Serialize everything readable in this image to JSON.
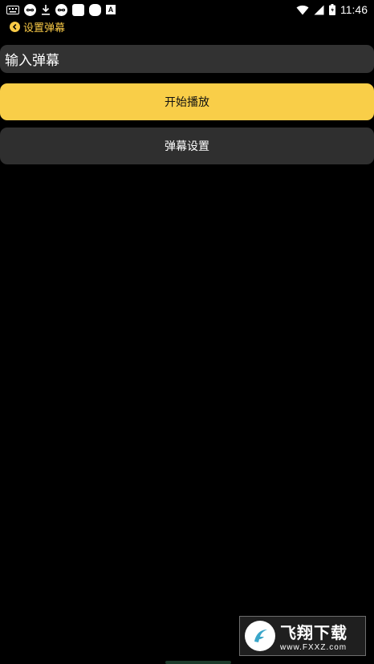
{
  "status_bar": {
    "time": "11:46",
    "icons": [
      "keyboard-icon",
      "infinity-app-icon",
      "download-icon",
      "infinity-app-icon",
      "app-square-icon",
      "app-rounded-icon",
      "a-letter-icon",
      "wifi-icon",
      "signal-icon",
      "battery-icon"
    ],
    "a_letter": "A"
  },
  "title_bar": {
    "title": "设置弹幕"
  },
  "input": {
    "placeholder": "输入弹幕"
  },
  "buttons": {
    "play": "开始播放",
    "settings": "弹幕设置"
  },
  "watermark": {
    "title": "飞翔下载",
    "url": "www.FXXZ.com"
  },
  "colors": {
    "accent": "#f9ce48",
    "background": "#000000",
    "panel": "#323232"
  }
}
